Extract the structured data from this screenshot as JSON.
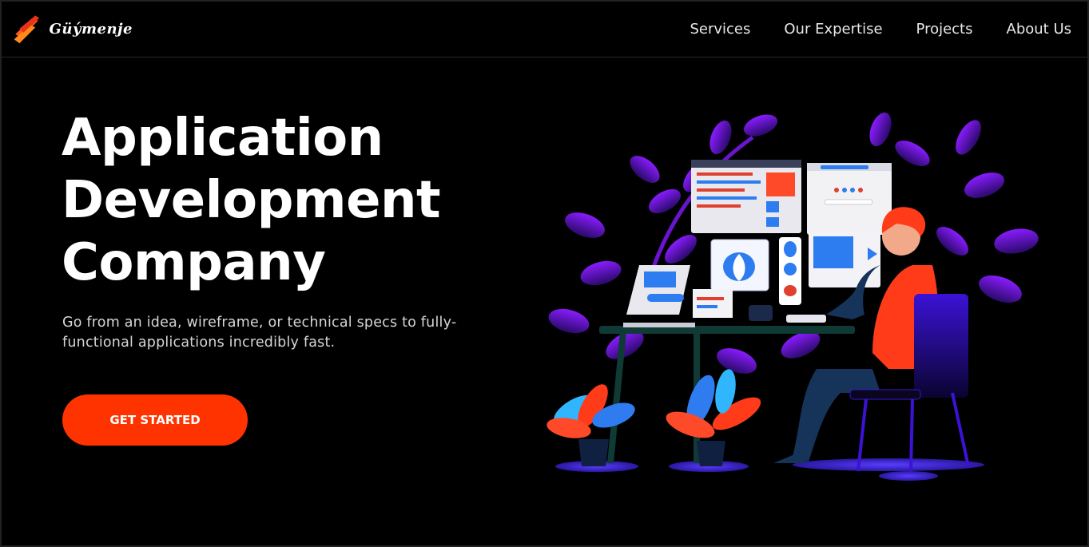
{
  "brand": {
    "name": "Güýmenje",
    "accent": "#ff3300"
  },
  "nav": {
    "items": [
      {
        "label": "Services"
      },
      {
        "label": "Our Expertise"
      },
      {
        "label": "Projects"
      },
      {
        "label": "About Us"
      }
    ]
  },
  "hero": {
    "title_lines": [
      "Application",
      "Development",
      "Company"
    ],
    "subtitle": "Go from an idea, wireframe, or technical specs to fully-functional applications incredibly fast.",
    "cta_label": "GET STARTED"
  },
  "illustration": {
    "icon": "developer-at-desk-illustration"
  }
}
